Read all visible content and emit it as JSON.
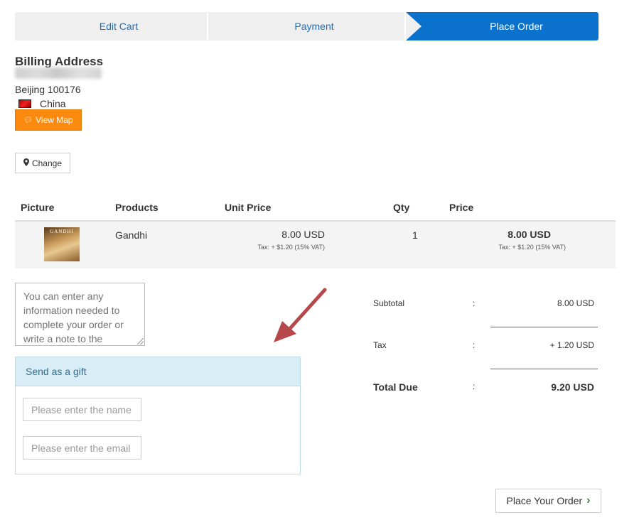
{
  "steps": [
    {
      "label": "Edit Cart"
    },
    {
      "label": "Payment"
    },
    {
      "label": "Place Order"
    }
  ],
  "billing": {
    "title": "Billing Address",
    "city_line": "Beijing 100176",
    "country": "China",
    "view_map_label": "View Map",
    "change_label": "Change"
  },
  "table": {
    "headers": {
      "picture": "Picture",
      "products": "Products",
      "unit_price": "Unit Price",
      "qty": "Qty",
      "price": "Price"
    },
    "rows": [
      {
        "thumb_text": "GANDHI",
        "product": "Gandhi",
        "unit_price": "8.00 USD",
        "unit_tax": "Tax: + $1.20 (15% VAT)",
        "qty": "1",
        "price": "8.00 USD",
        "price_tax": "Tax: + $1.20 (15% VAT)"
      }
    ]
  },
  "note": {
    "placeholder": "You can enter any information needed to complete your order or write a note to the"
  },
  "gift": {
    "title": "Send as a gift",
    "name_placeholder": "Please enter the name",
    "email_placeholder": "Please enter the email"
  },
  "totals": {
    "subtotal_label": "Subtotal",
    "subtotal_value": "8.00 USD",
    "tax_label": "Tax",
    "tax_value": "+ 1.20 USD",
    "due_label": "Total Due",
    "due_value": "9.20 USD",
    "colon": ":"
  },
  "place_order_label": "Place Your Order",
  "colors": {
    "active_step": "#0a72cc",
    "step_link": "#1e6fb8",
    "map_button": "#fb8a0f",
    "gift_header": "#d9edf7",
    "annotation_arrow": "#b5484a"
  },
  "icons": {
    "map_button": "comment-icon",
    "change_button": "map-marker-icon",
    "place_order": "chevron-right-icon"
  }
}
